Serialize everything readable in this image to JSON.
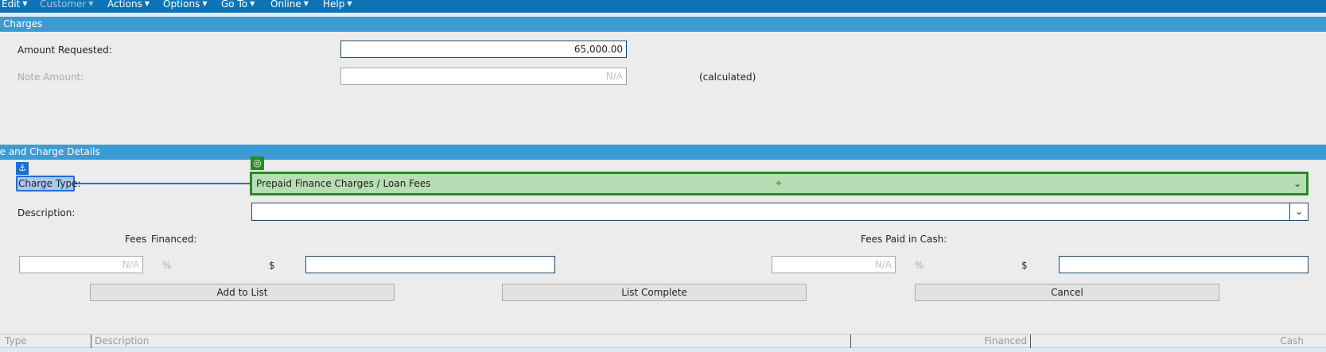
{
  "menubar": {
    "items": [
      {
        "label": "Edit",
        "disabled": false
      },
      {
        "label": "Customer",
        "disabled": true
      },
      {
        "label": "Actions",
        "disabled": false
      },
      {
        "label": "Options",
        "disabled": false
      },
      {
        "label": "Go To",
        "disabled": false
      },
      {
        "label": "Online",
        "disabled": false
      },
      {
        "label": "Help",
        "disabled": false
      }
    ]
  },
  "charges_section": {
    "title": "Charges",
    "amount_requested_label": "Amount Requested:",
    "amount_requested_value": "65,000.00",
    "note_amount_label": "Note Amount:",
    "note_amount_value": "N/A",
    "calculated_text": "(calculated)"
  },
  "details_section": {
    "title": "Fee and Charge Details",
    "charge_type_label": "Charge Type:",
    "charge_type_value": "Prepaid Finance Charges / Loan Fees",
    "description_label": "Description:",
    "description_value": "",
    "fees_label": "Fees",
    "financed_label": "Financed:",
    "fees_paid_cash_label": "Fees Paid in Cash:",
    "financed_percent_value": "N/A",
    "cash_percent_value": "N/A",
    "percent_sign": "%",
    "dollar_sign": "$",
    "financed_dollar_value": "",
    "cash_dollar_value": "",
    "add_button": "Add to List",
    "complete_button": "List Complete",
    "cancel_button": "Cancel"
  },
  "grid": {
    "columns": [
      "Type",
      "Description",
      "Financed",
      "Cash"
    ]
  },
  "icons": {
    "anchor": "anchor-icon",
    "target": "target-icon",
    "crosshair": "crosshair-icon",
    "dropdown": "chevron-down-icon"
  },
  "colors": {
    "menubar": "#0f74b6",
    "section_bar": "#3b9bd3",
    "highlight_green": "#2b8a23",
    "highlight_blue": "#1f6fd1"
  }
}
